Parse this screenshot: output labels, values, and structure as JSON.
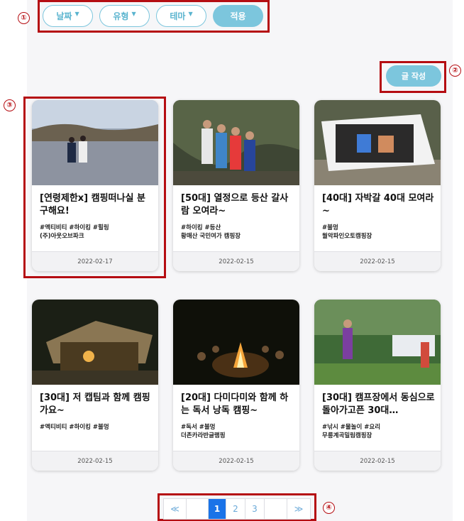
{
  "annotations": [
    "①",
    "②",
    "③",
    "④"
  ],
  "filters": {
    "date": "날짜",
    "type": "유형",
    "theme": "테마",
    "apply": "적용"
  },
  "write_button": "글 작성",
  "cards": [
    {
      "title": "[연령제한x] 캠핑떠나실 분 구해요!",
      "tags": "#액티비티 #하이킹 #힐링",
      "place": "(주)아웃오브파크",
      "date": "2022-02-17"
    },
    {
      "title": "[50대] 열정으로 등산 갈사람 오여라~",
      "tags": "#하이킹 #등산",
      "place": "황매산 국민여가 캠핑장",
      "date": "2022-02-15"
    },
    {
      "title": "[40대] 자박갈 40대 모여라~",
      "tags": "#불멍",
      "place": "월악파인오토캠핑장",
      "date": "2022-02-15"
    },
    {
      "title": "[30대] 저 캡팀과 함께 캠핑 가요~",
      "tags": "#액티비티 #하이킹 #불멍",
      "place": "",
      "date": "2022-02-15"
    },
    {
      "title": "[20대] 다미다미와 함께 하는 독서 낭독 캠핑~",
      "tags": "#독서 #불멍",
      "place": "더존카라반글램핑",
      "date": "2022-02-15"
    },
    {
      "title": "[30대] 캠프장에서 동심으로 돌아가고픈 30대…",
      "tags": "#낚시 #물놀이 #요리",
      "place": "무릉계곡밀림캠핑장",
      "date": "2022-02-15"
    }
  ],
  "pagination": {
    "first": "≪",
    "pages": [
      "1",
      "2",
      "3"
    ],
    "current": "1",
    "last": "≫"
  },
  "colors": {
    "accent": "#7cc6dd",
    "annotation": "#b50d12",
    "active_page": "#1a73e8"
  }
}
